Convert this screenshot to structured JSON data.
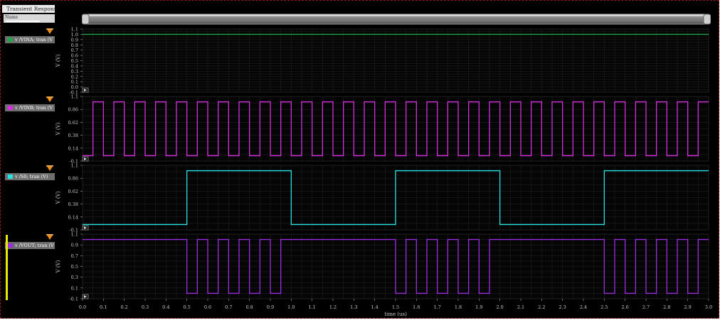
{
  "window": {
    "title": "Transient Response",
    "name_header": "Name"
  },
  "legend": [
    {
      "label": "v /VINA; tran (V",
      "color": "#1fa64a"
    },
    {
      "label": "v /VINB; tran (V",
      "color": "#d62ee0"
    },
    {
      "label": "v /S0; tran (V)",
      "color": "#27e0e0"
    },
    {
      "label": "v /VOUT; tran (V",
      "color": "#9a2ee0"
    }
  ],
  "icons": {
    "menu": "orange-triangle-menu-icon",
    "expand": "expand-arrow-icon",
    "scrollbar": "horizontal-scrollbar"
  },
  "colors": {
    "background": "#000000",
    "grid": "#2a2a2a",
    "axis_text": "#c8c8c8"
  },
  "chart_data": {
    "type": "line",
    "xlabel": "time (us)",
    "xlim": [
      0.0,
      3.0
    ],
    "x_ticks": [
      "0.0",
      "0.1",
      "0.2",
      "0.3",
      "0.4",
      "0.5",
      "0.6",
      "0.7",
      "0.8",
      "0.9",
      "1.0",
      "1.1",
      "1.2",
      "1.3",
      "1.4",
      "1.5",
      "1.6",
      "1.7",
      "1.8",
      "1.9",
      "2.0",
      "2.1",
      "2.2",
      "2.3",
      "2.4",
      "2.5",
      "2.6",
      "2.7",
      "2.8",
      "2.9",
      "3.0"
    ],
    "panels": [
      {
        "ylabel": "V (V)",
        "ylim": [
          -0.1,
          1.1
        ],
        "y_ticks": [
          "1.1",
          "1.0",
          "0.9",
          "0.8",
          "0.7",
          "0.6",
          "0.5",
          "0.4",
          "0.3",
          "0.2",
          "0.1",
          "0.0",
          "-0.1"
        ],
        "series": [
          {
            "name": "v /VINA; tran (V",
            "color": "#1fa64a",
            "x": [
              0.0,
              3.0
            ],
            "y": [
              1.0,
              1.0
            ]
          }
        ]
      },
      {
        "ylabel": "V (V)",
        "ylim": [
          -0.1,
          1.1
        ],
        "y_ticks": [
          "1.1",
          "0.86",
          "0.62",
          "0.38",
          "0.14",
          "-0.1"
        ],
        "series": [
          {
            "name": "v /VINB; tran (V",
            "color": "#d62ee0",
            "square": {
              "low": 0.0,
              "high": 1.0,
              "period": 0.1,
              "start_high": 0.05,
              "start": 0.0,
              "end": 3.0
            }
          }
        ]
      },
      {
        "ylabel": "V (V)",
        "ylim": [
          -0.1,
          1.1
        ],
        "y_ticks": [
          "1.1",
          "0.86",
          "0.62",
          "0.38",
          "0.14",
          "-0.1"
        ],
        "series": [
          {
            "name": "v /S0; tran (V)",
            "color": "#27e0e0",
            "x": [
              0.0,
              0.5,
              0.5,
              1.0,
              1.0,
              1.5,
              1.5,
              2.0,
              2.0,
              2.5,
              2.5,
              3.0
            ],
            "y": [
              0.0,
              0.0,
              1.0,
              1.0,
              0.0,
              0.0,
              1.0,
              1.0,
              0.0,
              0.0,
              1.0,
              1.0
            ]
          }
        ]
      },
      {
        "ylabel": "V (V)",
        "ylim": [
          -0.1,
          1.1
        ],
        "y_ticks": [
          "1.1",
          "0.9",
          "0.7",
          "0.5",
          "0.3",
          "0.1",
          "-0.1"
        ],
        "series": [
          {
            "name": "v /VOUT; tran (V",
            "color": "#9a2ee0",
            "segments": [
              {
                "type": "const",
                "from": 0.0,
                "to": 0.5,
                "y": 1.0
              },
              {
                "type": "square",
                "from": 0.5,
                "to": 1.0,
                "low": 0.0,
                "high": 1.0,
                "period": 0.1,
                "start_high": 0.05
              },
              {
                "type": "const",
                "from": 1.0,
                "to": 1.5,
                "y": 1.0
              },
              {
                "type": "square",
                "from": 1.5,
                "to": 2.0,
                "low": 0.0,
                "high": 1.0,
                "period": 0.1,
                "start_high": 0.05
              },
              {
                "type": "const",
                "from": 2.0,
                "to": 2.5,
                "y": 1.0
              },
              {
                "type": "square",
                "from": 2.5,
                "to": 3.0,
                "low": 0.0,
                "high": 1.0,
                "period": 0.1,
                "start_high": 0.05
              }
            ]
          }
        ]
      }
    ]
  }
}
